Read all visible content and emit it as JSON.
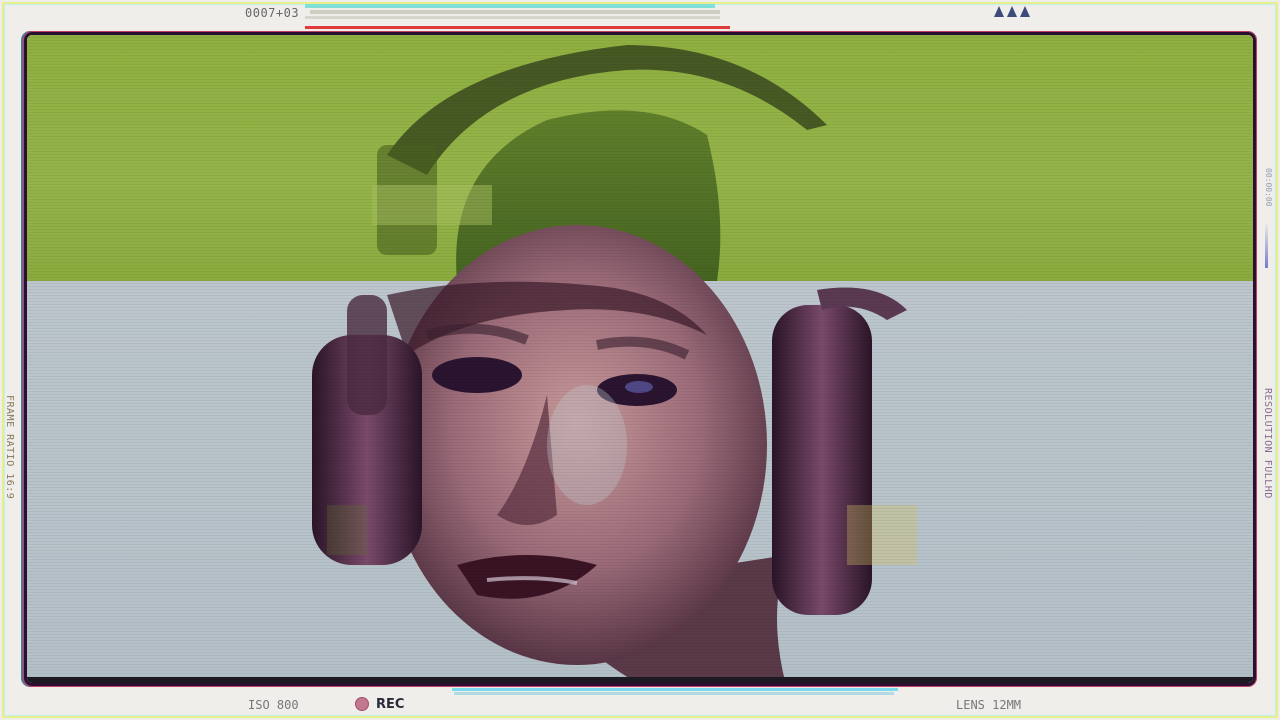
{
  "overlay": {
    "timecode": "0007+03",
    "frame_ratio": "FRAME RATIO 16:9",
    "resolution": "RESOLUTION FULLHD",
    "right_timecode": "00:00:00",
    "iso": "ISO 800",
    "rec": "REC",
    "lens": "LENS 12MM"
  },
  "colors": {
    "top_band": "#8fb040",
    "bottom_band": "#bcc6cc",
    "rec_dot": "#c47890",
    "accent_red": "#e03a3a",
    "accent_cyan": "#7fe0d8"
  },
  "icons": [
    "battery-triangle-icon",
    "battery-triangle-icon",
    "battery-triangle-icon",
    "rec-dot-icon"
  ]
}
